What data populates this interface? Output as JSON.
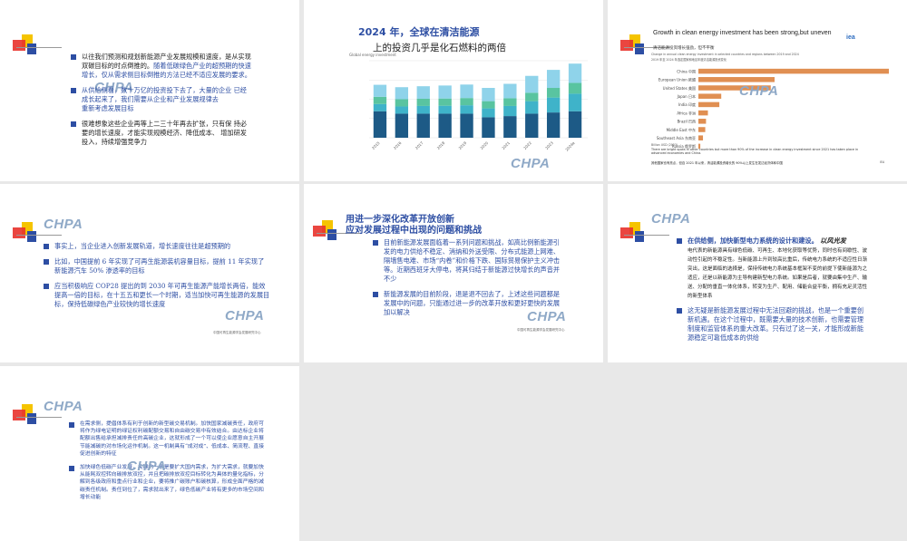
{
  "logo": {
    "name": "CHPA",
    "sub": "中国电力企业联合会"
  },
  "slide1": {
    "paragraphs": [
      {
        "a": "以往我们预测和规划新能源产业发展规模和速度，是从实现双碳目标的时点倒推的。",
        "b": "随着低碳绿色产业的超预期的快速增长，仅从需求侧目标倒推的方法已经不适应发展的要求。"
      },
      {
        "a": "从供给侧看，数十万亿的投资投下去了，大量的企业 已经成长起来了，我们需要从企业和产业发展规律去",
        "b": "重新考虑发展目标"
      },
      {
        "a": "很难想象这些企业再等上二三十年再去扩张，只有保 持必要的增长速度，才能实现规模经济、降低成本、 增加研发投入，持续增强竞争力"
      }
    ]
  },
  "slide2": {
    "title1": "2024 年，全球在清洁能源",
    "title2": "上的投资几乎是化石燃料的两倍",
    "chart_note": "Global energy investment",
    "chart_data": {
      "type": "bar",
      "categories": [
        "2015",
        "2016",
        "2017",
        "2018",
        "2019",
        "2020",
        "2021",
        "2022",
        "2023",
        "2024e"
      ],
      "series": [
        {
          "name": "Fossil fuels",
          "color": "#1d5a86",
          "values": [
            1.1,
            1.0,
            1.0,
            1.0,
            1.0,
            0.85,
            0.9,
            1.0,
            1.05,
            1.1
          ]
        },
        {
          "name": "Renewable power",
          "color": "#3fb3c9",
          "values": [
            0.3,
            0.3,
            0.32,
            0.33,
            0.35,
            0.37,
            0.42,
            0.52,
            0.62,
            0.73
          ]
        },
        {
          "name": "Grids and storage",
          "color": "#59c4a0",
          "values": [
            0.3,
            0.3,
            0.3,
            0.3,
            0.3,
            0.3,
            0.32,
            0.35,
            0.4,
            0.45
          ]
        },
        {
          "name": "End use",
          "color": "#8fd3ea",
          "values": [
            0.5,
            0.5,
            0.52,
            0.54,
            0.56,
            0.55,
            0.6,
            0.7,
            0.75,
            0.8
          ]
        }
      ],
      "ylim": [
        0,
        3.2
      ]
    }
  },
  "slide3": {
    "title_en": "Growth in clean energy investment has been strong,but uneven",
    "title_cn": "清洁能源投资增长强劲，但不平衡",
    "corner": "iea",
    "chart_heading_en": "Change in annual clean energy investment in selected countries and regions between 2019 and 2024",
    "chart_heading_cn": "2019 年至 2024 年选定国家和地区年度清洁能源投资变化",
    "chart_data": {
      "type": "bar",
      "orientation": "horizontal",
      "categories": [
        "China 中国",
        "European Union 欧盟",
        "United States 美国",
        "Japan 日本",
        "India 印度",
        "Africa 非洲",
        "Brazil 巴西",
        "Middle East 中东",
        "Southeast Asia 东南亚",
        "Russia 俄罗斯"
      ],
      "values": [
        500,
        200,
        190,
        60,
        55,
        25,
        20,
        18,
        12,
        5
      ],
      "color": "#e08f52"
    },
    "footer_en": "Billion USD (2023)",
    "footer_note": "There are bright spots in other countries but more than 90% of the increase in clean energy investment since 2021 has taken place in advanced economies and China.",
    "footer_cn": "其他国家也有亮点，但自 2021 年以来，清洁能源投资增长的 90%以上发生在发达经济体和中国",
    "page": "IEA"
  },
  "slide4": {
    "paragraphs": [
      "事实上，当企业进入创新发展轨道，增长速度往往是超预期的",
      "比如，中国提前 6 年实现了可再生能源装机容量目标，提前 11 年实现了新能源汽车 50% 渗透率的目标",
      "应当积极响应 COP28 提出的到 2030 年可再生能源产能增长两倍，能效提高一倍的目标，在十五五和更长一个时期，适当加快可再生能源的发展目标，保持低碳绿色产业较快的增长速度"
    ],
    "footnote": "中国可再生能源学会发展研究中心"
  },
  "slide5": {
    "title1": "用进一步深化改革开放创新",
    "title2": "应对发展过程中出现的问题和挑战",
    "paragraphs": [
      "目前新能源发展面临着一系列问题和挑战，如高比例新能源引发的电力供给不稳定、消纳和外送受限、分布式能源上网难、隔墙售电难、市场“内卷”和价格下跌、国际贸易保护主义冲击等。近期西班牙大停电，将其归结于新能源过快增长的声音并不少",
      "新能源发展的目前阶段，退是退不回去了，上述这些问题都是发展中的问题，只能通过进一步的改革开放和更好更快的发展加以解决"
    ],
    "footnote": "中国可再生能源学会发展研究中心"
  },
  "slide6": {
    "heading": "在供给侧，加快新型电力系统的设计和建设。",
    "heading_tail": "以风光发",
    "p1": "电代表的新能源具有绿色低碳、可再生、本地化获取等优势，同时也有间歇性、波动性引起的不稳定性。当新能源上升到较高比重后，传统电力系统的不适应性日渐突出，这是面临的选择是，保持传统电力系统基本框架不变的前提下使新能源为之适应，还是以新能源为主导构建新型电力系统。如果是后者，就要由集中生产、输送、分配的垂直一体化体系，转变为生产、配用、储能合益平衡，拥有充足灵活性的新型体系",
    "p2": "这无疑是新能源发展过程中无法回避的挑战，也是一个重要创新机遇。在这个过程中，既需要大量的技术创新，也需要管理制度和监管体系的重大改革。只有过了这一关，才能形成新能源稳定可靠低成本的供给"
  },
  "slide7": {
    "p1": "在需求侧，提倡体系有利于创新的新型碳交易机制。加快国家减碳责任，政府可将作为绿电证明的绿证权利碳配额交易和自由碳交易中有效结合。由达标企业将配额出售给承担减排责任的高碳企业，这就形成了一个可以使企业愿意自主开展节能减碳的对市场化运作机制。这一机制具有“成对成”、低成本、简流程、直接促进创新的特征",
    "p2": "加快绿色低碳产业发展，关键的一条是要扩大国内需求，为扩大需求，就要加快从能耗双控转向碳排放双控，并且把碳排放双控目标转化为具体的量化指标，分解到各级政府和重点行业和企业，要将推广碳账户和碳核算，形成全面严格的减碳责任机制。责任到位了，需求就出来了，绿色低碳产业将有更多的市场空间和增长动能"
  }
}
